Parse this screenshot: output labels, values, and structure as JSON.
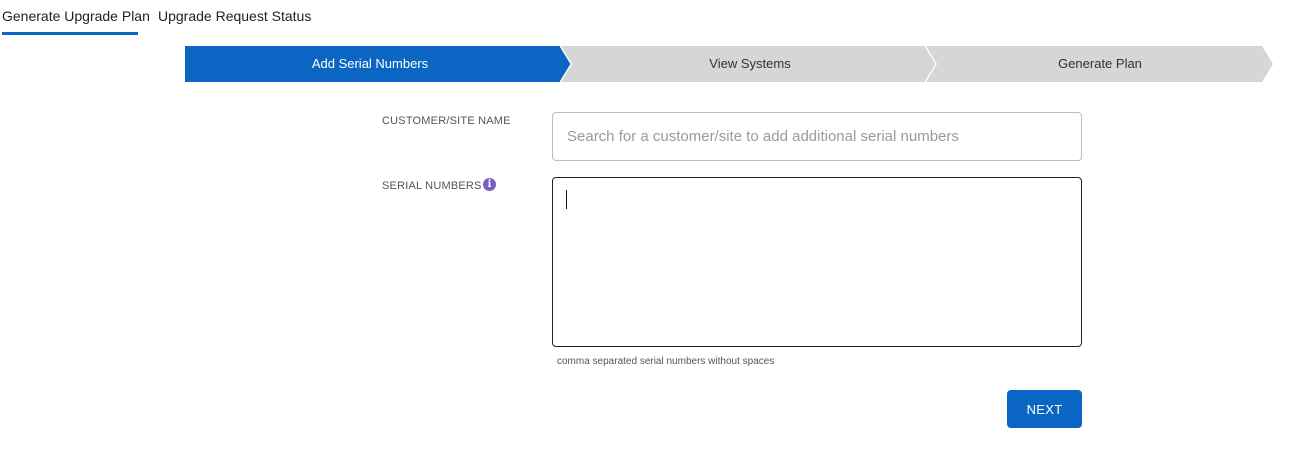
{
  "tabs": [
    {
      "label": "Generate Upgrade Plan",
      "active": true
    },
    {
      "label": "Upgrade Request Status",
      "active": false
    }
  ],
  "wizard": {
    "steps": [
      {
        "label": "Add Serial Numbers",
        "state": "active"
      },
      {
        "label": "View Systems",
        "state": "inactive"
      },
      {
        "label": "Generate Plan",
        "state": "inactive"
      }
    ],
    "colors": {
      "active": "#0a66c2",
      "inactive": "#d6d6d6",
      "separator": "#ffffff"
    }
  },
  "form": {
    "customer": {
      "label": "CUSTOMER/SITE NAME",
      "value": "",
      "placeholder": "Search for a customer/site to add additional serial numbers"
    },
    "serials": {
      "label": "SERIAL NUMBERS",
      "info_icon": "info-circle-icon",
      "value": "",
      "helper": "comma separated serial numbers without spaces"
    },
    "next_label": "NEXT"
  },
  "colors": {
    "accent": "#0a66c2",
    "info_icon": "#7a5fc0"
  }
}
